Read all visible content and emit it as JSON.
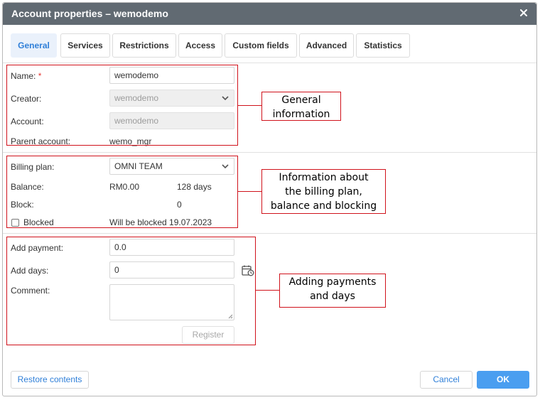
{
  "dialog": {
    "title": "Account properties – wemodemo",
    "close_icon": "close-icon"
  },
  "tabs": [
    {
      "label": "General",
      "active": true
    },
    {
      "label": "Services",
      "active": false
    },
    {
      "label": "Restrictions",
      "active": false
    },
    {
      "label": "Access",
      "active": false
    },
    {
      "label": "Custom fields",
      "active": false
    },
    {
      "label": "Advanced",
      "active": false
    },
    {
      "label": "Statistics",
      "active": false
    }
  ],
  "general": {
    "name_label": "Name:",
    "name_required": "*",
    "name_value": "wemodemo",
    "creator_label": "Creator:",
    "creator_value": "wemodemo",
    "account_label": "Account:",
    "account_value": "wemodemo",
    "parent_label": "Parent account:",
    "parent_value": "wemo_mgr"
  },
  "billing": {
    "plan_label": "Billing plan:",
    "plan_value": "OMNI TEAM",
    "balance_label": "Balance:",
    "balance_value": "RM0.00",
    "days_value": "128 days",
    "block_label": "Block:",
    "block_value": "0",
    "blocked_label": "Blocked",
    "blocked_checked": false,
    "will_be_blocked": "Will be blocked 19.07.2023"
  },
  "payment": {
    "add_payment_label": "Add payment:",
    "add_payment_value": "0.0",
    "add_days_label": "Add days:",
    "add_days_value": "0",
    "comment_label": "Comment:",
    "comment_value": "",
    "register_label": "Register",
    "calendar_icon": "calendar-clock-icon"
  },
  "footer": {
    "restore_label": "Restore contents",
    "cancel_label": "Cancel",
    "ok_label": "OK"
  },
  "annotations": {
    "general_line1": "General",
    "general_line2": "information",
    "billing_line1": "Information about",
    "billing_line2": "the billing plan,",
    "billing_line3": "balance and blocking",
    "payment_line1": "Adding payments",
    "payment_line2": "and days"
  },
  "colors": {
    "titlebar": "#616a72",
    "accent": "#2f7fd8",
    "primary_button": "#4a9ef0",
    "annotation_red": "#d0121b"
  }
}
